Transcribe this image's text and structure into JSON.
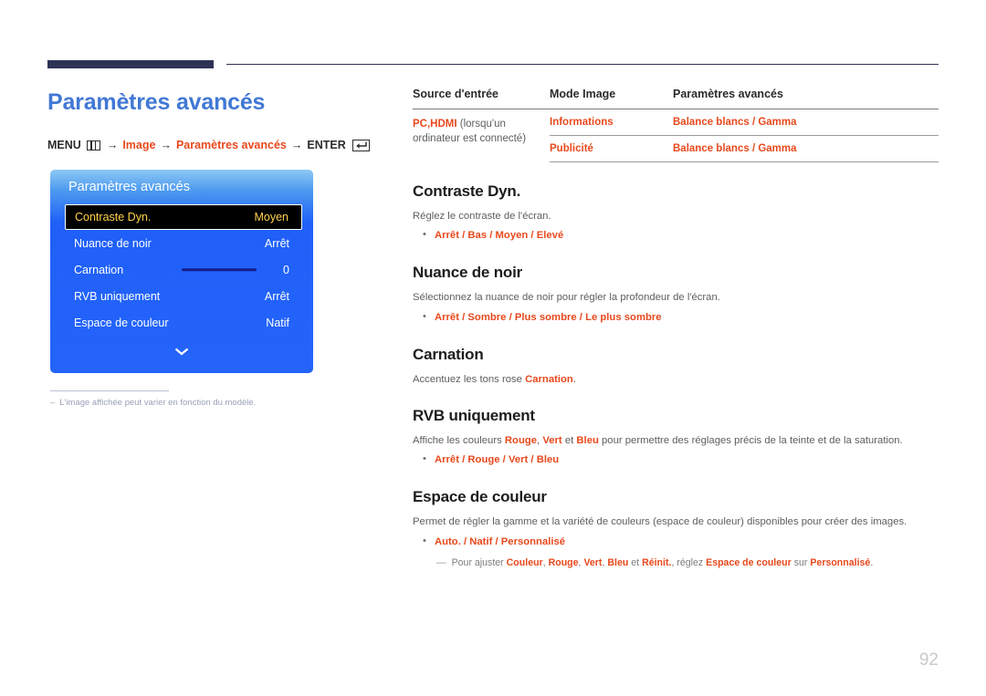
{
  "header": {
    "title": "Paramètres avancés",
    "breadcrumb": {
      "menu_label": "MENU",
      "menu_icon": "menu-bars-icon",
      "arrow": "→",
      "step1": "Image",
      "step2": "Paramètres avancés",
      "enter_label": "ENTER",
      "enter_icon": "enter-return-icon"
    }
  },
  "osd": {
    "title": "Paramètres avancés",
    "rows": [
      {
        "label": "Contraste Dyn.",
        "value": "Moyen",
        "selected": true,
        "slider": false
      },
      {
        "label": "Nuance de noir",
        "value": "Arrêt",
        "selected": false,
        "slider": false
      },
      {
        "label": "Carnation",
        "value": "0",
        "selected": false,
        "slider": true
      },
      {
        "label": "RVB uniquement",
        "value": "Arrêt",
        "selected": false,
        "slider": false
      },
      {
        "label": "Espace de couleur",
        "value": "Natif",
        "selected": false,
        "slider": false
      }
    ],
    "more_icon": "chevron-down-icon"
  },
  "left_note": {
    "dash": "–",
    "text": "L'image affichée peut varier en fonction du modèle."
  },
  "table": {
    "headers": [
      "Source d'entrée",
      "Mode Image",
      "Paramètres avancés"
    ],
    "rows": [
      {
        "source_accent": "PC,HDMI",
        "source_muted": " (lorsqu'un ordinateur est connecté)",
        "mode": "Informations",
        "advanced_a": "Balance blancs",
        "advanced_sep": "/",
        "advanced_b": "Gamma"
      },
      {
        "source_accent": "",
        "source_muted": "",
        "mode": "Publicité",
        "advanced_a": "Balance blancs",
        "advanced_sep": "/",
        "advanced_b": "Gamma"
      }
    ]
  },
  "sections": [
    {
      "heading": "Contraste Dyn.",
      "desc": "Réglez le contraste de l'écran.",
      "bullet": "Arrêt / Bas / Moyen / Elevé"
    },
    {
      "heading": "Nuance de noir",
      "desc": "Sélectionnez la nuance de noir pour régler la profondeur de l'écran.",
      "bullet": "Arrêt / Sombre / Plus sombre / Le plus sombre"
    },
    {
      "heading": "Carnation",
      "desc_pre": "Accentuez les tons rose ",
      "desc_accent": "Carnation",
      "desc_post": "."
    },
    {
      "heading": "RVB uniquement",
      "desc_pre": "Affiche les couleurs ",
      "desc_a": "Rouge",
      "desc_mid1": ", ",
      "desc_b": "Vert",
      "desc_mid2": " et ",
      "desc_c": "Bleu",
      "desc_post": " pour permettre des réglages précis de la teinte et de la saturation.",
      "bullet": "Arrêt / Rouge / Vert / Bleu"
    },
    {
      "heading": "Espace de couleur",
      "desc": "Permet de régler la gamme et la variété de couleurs (espace de couleur) disponibles pour créer des images.",
      "bullet": "Auto. / Natif / Personnalisé",
      "subnote": {
        "dash": "—",
        "pre": "Pour ajuster ",
        "a": "Couleur",
        "s1": ", ",
        "b": "Rouge",
        "s2": ", ",
        "c": "Vert",
        "s3": ", ",
        "d": "Bleu",
        "s4": " et ",
        "e": "Réinit.",
        "s5": ", réglez ",
        "f": "Espace de couleur",
        "s6": " sur ",
        "g": "Personnalisé",
        "s7": "."
      }
    }
  ],
  "page_number": "92",
  "colors": {
    "title_blue": "#4178d5",
    "accent_orange": "#e8491d",
    "rule_navy": "#2e3356",
    "osd_blue": "#2464fb",
    "osd_selected_text": "#ffd24a"
  }
}
